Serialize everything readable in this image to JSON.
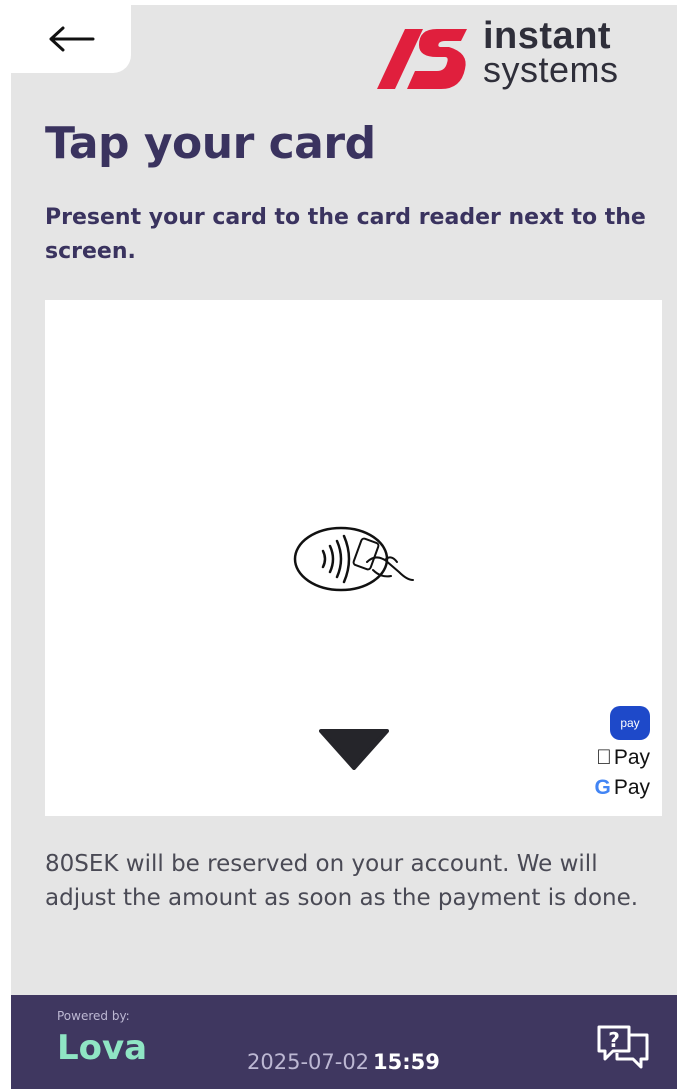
{
  "header": {
    "back_icon": "arrow-left-icon",
    "logo": {
      "line1": "instant",
      "line2": "systems",
      "mark_color": "#e01f3d"
    }
  },
  "main": {
    "title": "Tap your card",
    "subtitle": "Present your card to the card reader next to the screen.",
    "contactless_icon": "contactless-card-tap-icon",
    "down_arrow_icon": "triangle-down-icon",
    "wallets": {
      "samsung_pay": "pay",
      "apple_pay": "Pay",
      "google_pay": "Pay"
    },
    "notice": "80SEK will be reserved on your account. We will adjust the amount as soon as the payment is done."
  },
  "footer": {
    "powered_by": "Powered by:",
    "brand": "Lova",
    "date": "2025-07-02",
    "time": "15:59",
    "help_icon": "help-chat-icon"
  },
  "colors": {
    "background": "#e5e5e5",
    "heading": "#3a335f",
    "footer": "#3f3760",
    "brand": "#8fe5c4",
    "logo_red": "#e01f3d"
  }
}
